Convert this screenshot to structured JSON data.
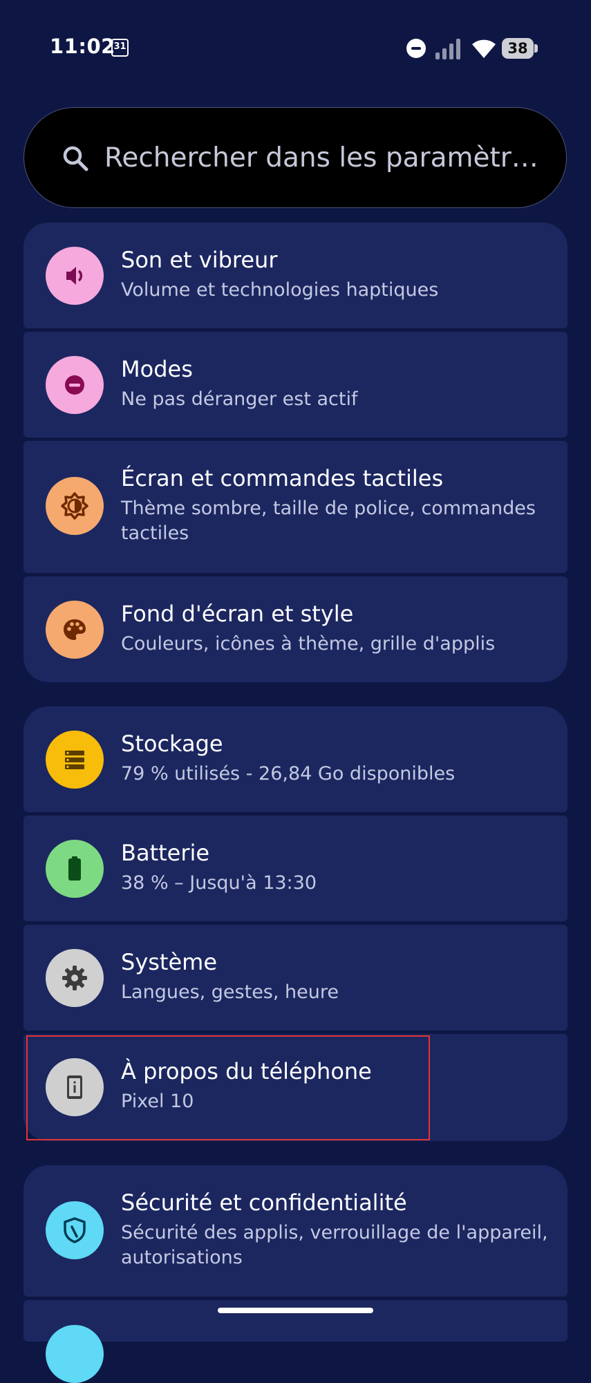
{
  "status_bar": {
    "time": "11:02",
    "calendar_day": "31",
    "battery_level": "38",
    "icons": [
      "calendar-icon",
      "do-not-disturb-icon",
      "signal-icon",
      "wifi-icon",
      "battery-icon"
    ]
  },
  "search": {
    "placeholder": "Rechercher dans les paramètr…",
    "icon": "search-icon"
  },
  "items": [
    {
      "title": "Son et vibreur",
      "subtitle": "Volume et technologies haptiques",
      "icon": "speaker-icon",
      "icon_bg": "#f6a9dc",
      "icon_fg": "#7a0e55"
    },
    {
      "title": "Modes",
      "subtitle": "Ne pas déranger est actif",
      "icon": "do-not-disturb-icon",
      "icon_bg": "#f6a9dc",
      "icon_fg": "#8a0a52"
    },
    {
      "title": "Écran et commandes tactiles",
      "subtitle": "Thème sombre, taille de police, commandes tactiles",
      "icon": "brightness-icon",
      "icon_bg": "#f6a96e",
      "icon_fg": "#6e2a00"
    },
    {
      "title": "Fond d'écran et style",
      "subtitle": "Couleurs, icônes à thème, grille d'applis",
      "icon": "palette-icon",
      "icon_bg": "#f6a96e",
      "icon_fg": "#6e2a00"
    },
    {
      "title": "Stockage",
      "subtitle": "79 % utilisés - 26,84 Go disponibles",
      "icon": "storage-icon",
      "icon_bg": "#f7bd0a",
      "icon_fg": "#5c3d00"
    },
    {
      "title": "Batterie",
      "subtitle": "38 % – Jusqu'à 13:30",
      "icon": "battery-icon",
      "icon_bg": "#7ed983",
      "icon_fg": "#0b4d18"
    },
    {
      "title": "Système",
      "subtitle": "Langues, gestes, heure",
      "icon": "gear-icon",
      "icon_bg": "#d0d0d0",
      "icon_fg": "#3c3c3c"
    },
    {
      "title": "À propos du téléphone",
      "subtitle": "Pixel 10",
      "icon": "phone-info-icon",
      "icon_bg": "#cfcfcf",
      "icon_fg": "#3d3d3d"
    },
    {
      "title": "Sécurité et confidentialité",
      "subtitle": "Sécurité des applis, verrouillage de l'appareil, autorisations",
      "icon": "shield-icon",
      "icon_bg": "#5fd9f5",
      "icon_fg": "#003c55"
    }
  ],
  "colors": {
    "background": "#0e1744",
    "card": "#1c2760",
    "highlight": "#e23434"
  }
}
